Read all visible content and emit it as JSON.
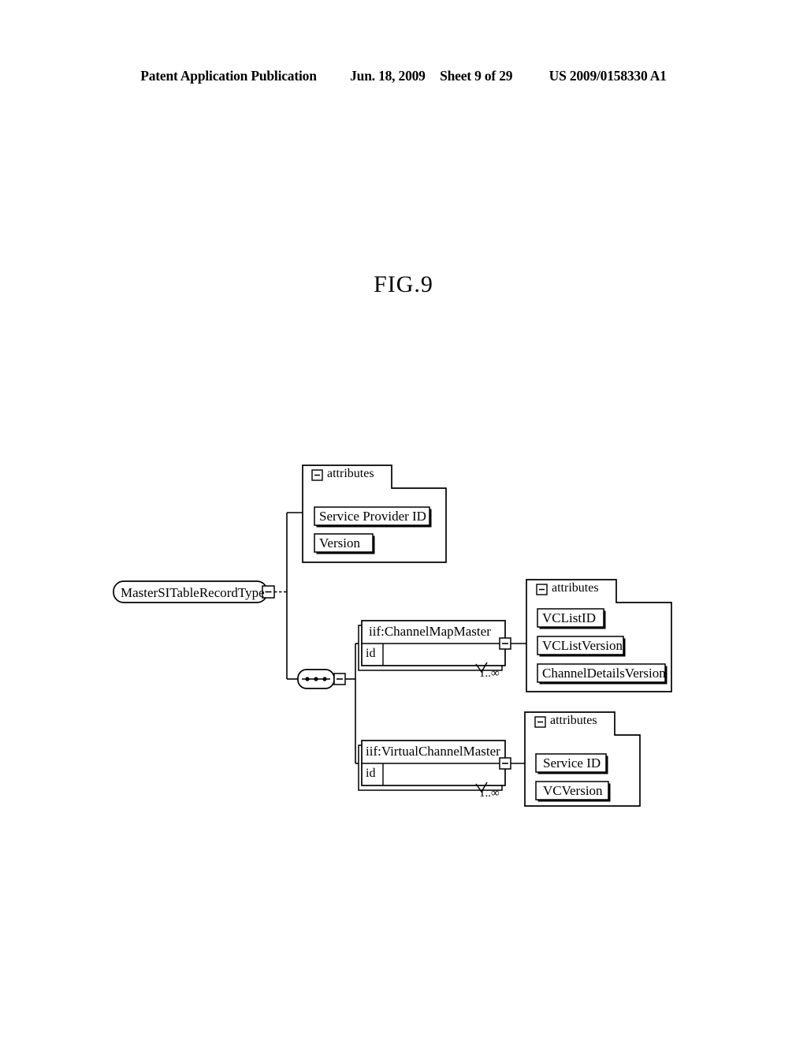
{
  "header": {
    "publication": "Patent Application Publication",
    "date": "Jun. 18, 2009",
    "sheet": "Sheet 9 of 29",
    "patent_number": "US 2009/0158330 A1"
  },
  "figure": {
    "caption": "FIG.9",
    "type": "xml-schema-tree"
  },
  "diagram": {
    "root": {
      "label": "MasterSITableRecordType",
      "expander": "minus"
    },
    "compositor": {
      "kind": "sequence",
      "glyph": "•••",
      "expander": "minus"
    },
    "attribute_groups": [
      {
        "id": "root-attributes",
        "header": "attributes",
        "expander": "minus",
        "items": [
          "Service Provider ID",
          "Version"
        ]
      },
      {
        "id": "channelmapmaster-attributes",
        "header": "attributes",
        "expander": "minus",
        "items": [
          "VCListID",
          "VCListVersion",
          "ChannelDetailsVersion"
        ]
      },
      {
        "id": "virtualchannelmaster-attributes",
        "header": "attributes",
        "expander": "minus",
        "items": [
          "Service  ID",
          "VCVersion"
        ]
      }
    ],
    "elements": [
      {
        "id": "channelmapmaster",
        "label": "iif:ChannelMapMaster",
        "field": "id",
        "cardinality": "1..∞",
        "expander": "minus",
        "repeating": true
      },
      {
        "id": "virtualchannelmaster",
        "label": "iif:VirtualChannelMaster",
        "field": "id",
        "cardinality": "1..∞",
        "expander": "minus",
        "repeating": true
      }
    ],
    "colors": {
      "stroke": "#000000",
      "fill": "#ffffff",
      "background": "#ffffff"
    }
  }
}
